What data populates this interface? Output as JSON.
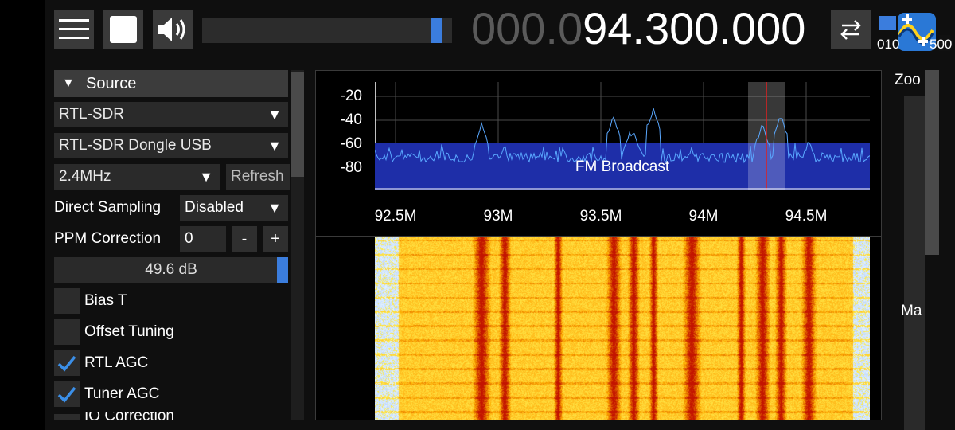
{
  "toolbar": {
    "menu_icon": "hamburger-icon",
    "play_icon": "stop-icon",
    "volume_icon": "speaker-icon",
    "volume_level": 0.96,
    "frequency_dim": "000.0",
    "frequency_bright": "94.300.000",
    "swap_icon": "swap-arrows-icon",
    "snap_label_left": "010",
    "snap_label_right": "500",
    "logo_icon": "sdr-app-logo-icon"
  },
  "source_panel": {
    "header": "Source",
    "source_type": "RTL-SDR",
    "device": "RTL-SDR Dongle USB",
    "sample_rate": "2.4MHz",
    "refresh_label": "Refresh",
    "direct_sampling_label": "Direct Sampling",
    "direct_sampling_value": "Disabled",
    "ppm_label": "PPM Correction",
    "ppm_value": "0",
    "ppm_minus": "-",
    "ppm_plus": "+",
    "gain_value": "49.6 dB",
    "gain_level": 1.0,
    "checkboxes": [
      {
        "label": "Bias T",
        "checked": false
      },
      {
        "label": "Offset Tuning",
        "checked": false
      },
      {
        "label": "RTL AGC",
        "checked": true
      },
      {
        "label": "Tuner AGC",
        "checked": true
      }
    ],
    "partial_item": "IQ Correction"
  },
  "spectrum": {
    "y_ticks": [
      "-20",
      "-40",
      "-60",
      "-80"
    ],
    "x_ticks": [
      "92.5M",
      "93M",
      "93.5M",
      "94M",
      "94.5M"
    ],
    "band_label": "FM Broadcast",
    "accent_color": "#1e2ea8",
    "vfo_color": "#e02020"
  },
  "right_panel": {
    "zoom_label": "Zoo",
    "max_label": "Ma",
    "zoom_level": 0.12
  },
  "colors": {
    "accent": "#3b7ddd",
    "background": "#0f0f0f",
    "panel": "#2a2a2a"
  }
}
